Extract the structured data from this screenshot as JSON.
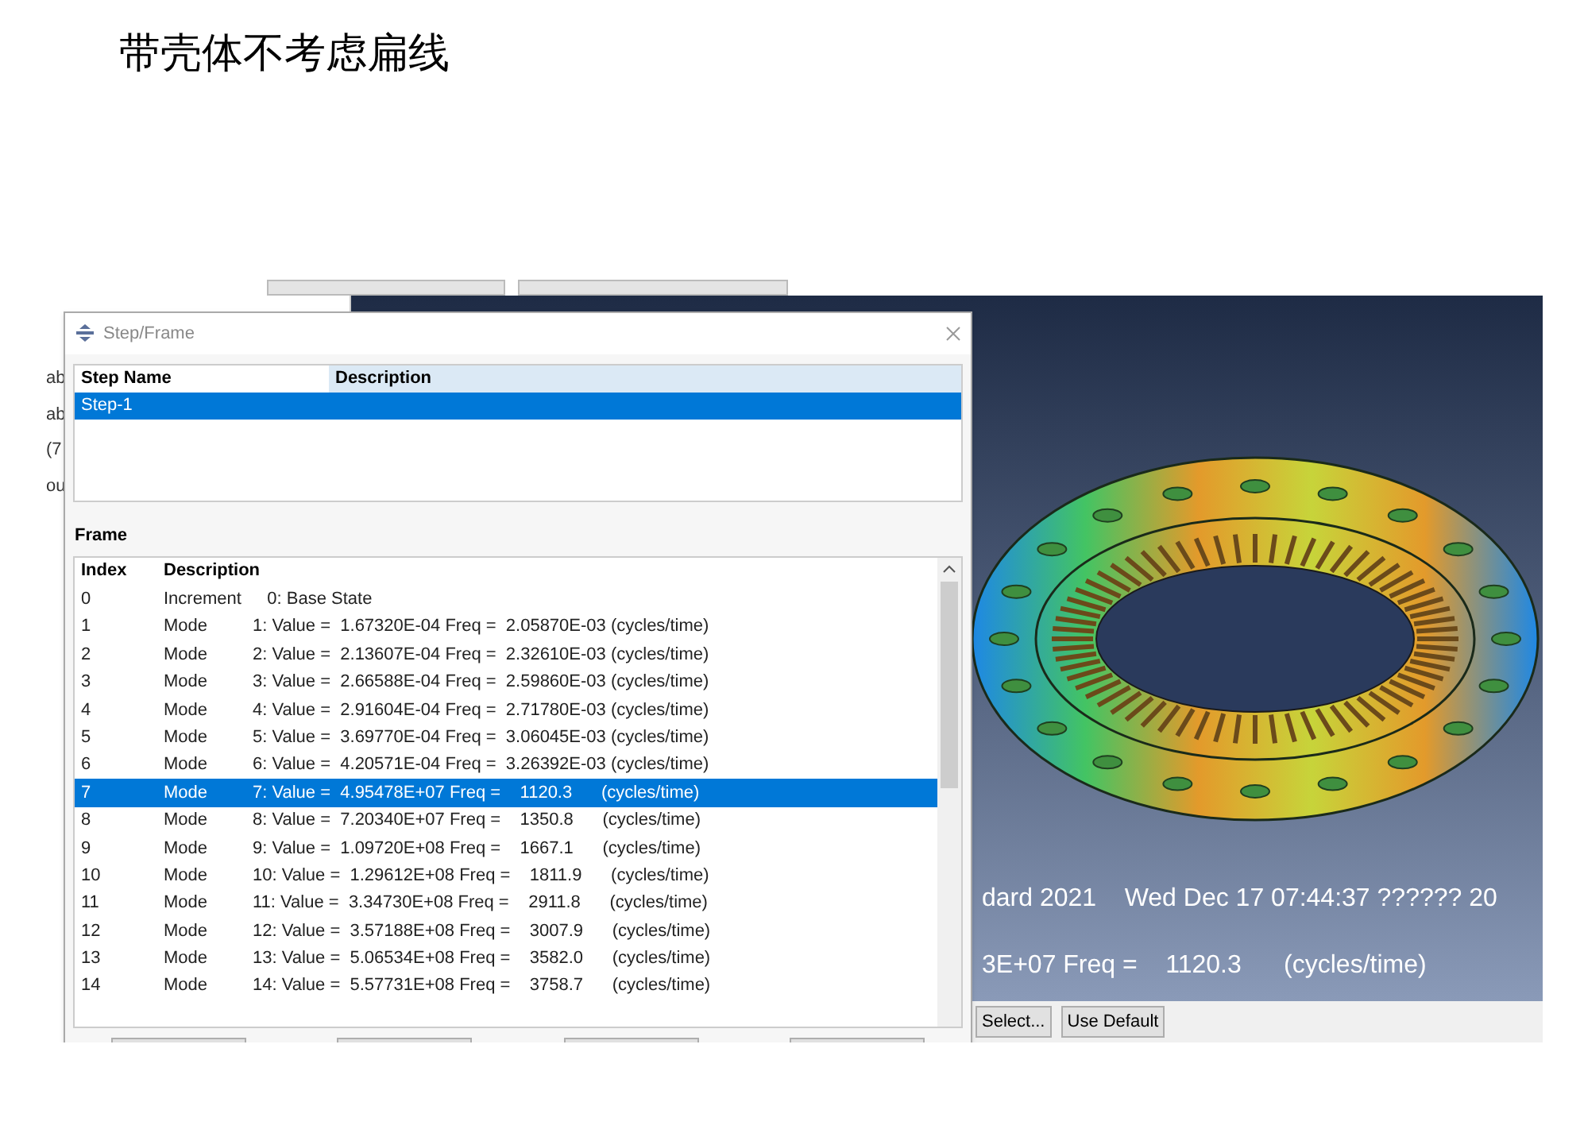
{
  "page_title": "带壳体不考虑扁线",
  "left_panel": {
    "fragments": [
      "ab",
      "ab",
      "(7",
      "ou"
    ]
  },
  "viewport": {
    "lines": [
      "dard 2021    Wed Dec 17 07:44:37 ?????? 20",
      "3E+07 Freq =    1120.3      (cycles/time)"
    ],
    "buttons": [
      "Select...",
      "Use Default"
    ]
  },
  "dialog": {
    "title": "Step/Frame",
    "step_table": {
      "columns": [
        "Step Name",
        "Description"
      ],
      "rows": [
        {
          "name": "Step-1",
          "selected": true
        }
      ]
    },
    "frame_label": "Frame",
    "frame_table": {
      "columns": [
        "Index",
        "Description"
      ],
      "rows": [
        {
          "index": "0",
          "type": "Increment",
          "description": "   0: Base State",
          "selected": false
        },
        {
          "index": "1",
          "type": "Mode",
          "description": "1: Value =  1.67320E-04 Freq =  2.05870E-03 (cycles/time)",
          "selected": false
        },
        {
          "index": "2",
          "type": "Mode",
          "description": "2: Value =  2.13607E-04 Freq =  2.32610E-03 (cycles/time)",
          "selected": false
        },
        {
          "index": "3",
          "type": "Mode",
          "description": "3: Value =  2.66588E-04 Freq =  2.59860E-03 (cycles/time)",
          "selected": false
        },
        {
          "index": "4",
          "type": "Mode",
          "description": "4: Value =  2.91604E-04 Freq =  2.71780E-03 (cycles/time)",
          "selected": false
        },
        {
          "index": "5",
          "type": "Mode",
          "description": "5: Value =  3.69770E-04 Freq =  3.06045E-03 (cycles/time)",
          "selected": false
        },
        {
          "index": "6",
          "type": "Mode",
          "description": "6: Value =  4.20571E-04 Freq =  3.26392E-03 (cycles/time)",
          "selected": false
        },
        {
          "index": "7",
          "type": "Mode",
          "description": "7: Value =  4.95478E+07 Freq =    1120.3      (cycles/time)",
          "selected": true
        },
        {
          "index": "8",
          "type": "Mode",
          "description": "8: Value =  7.20340E+07 Freq =    1350.8      (cycles/time)",
          "selected": false
        },
        {
          "index": "9",
          "type": "Mode",
          "description": "9: Value =  1.09720E+08 Freq =    1667.1      (cycles/time)",
          "selected": false
        },
        {
          "index": "10",
          "type": "Mode",
          "description": "10: Value =  1.29612E+08 Freq =    1811.9      (cycles/time)",
          "selected": false
        },
        {
          "index": "11",
          "type": "Mode",
          "description": "11: Value =  3.34730E+08 Freq =    2911.8      (cycles/time)",
          "selected": false
        },
        {
          "index": "12",
          "type": "Mode",
          "description": "12: Value =  3.57188E+08 Freq =    3007.9      (cycles/time)",
          "selected": false
        },
        {
          "index": "13",
          "type": "Mode",
          "description": "13: Value =  5.06534E+08 Freq =    3582.0      (cycles/time)",
          "selected": false
        },
        {
          "index": "14",
          "type": "Mode",
          "description": "14: Value =  5.57731E+08 Freq =    3758.7      (cycles/time)",
          "selected": false
        }
      ]
    }
  }
}
